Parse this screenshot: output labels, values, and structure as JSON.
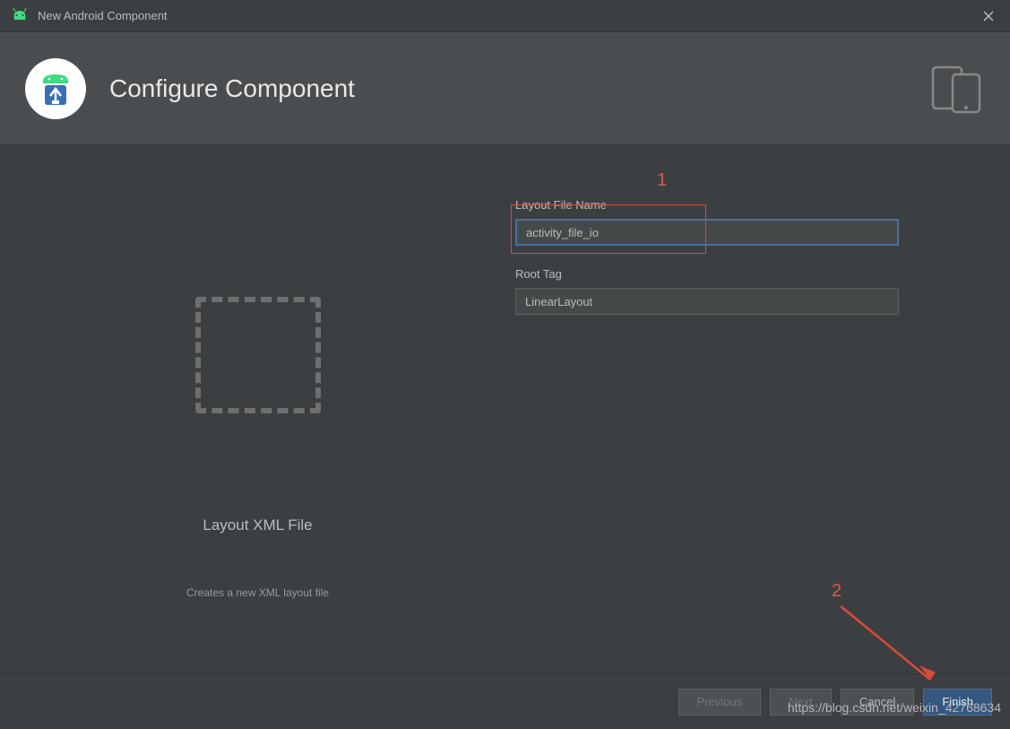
{
  "titlebar": {
    "title": "New Android Component"
  },
  "header": {
    "title": "Configure Component"
  },
  "form": {
    "layout_file_name": {
      "label": "Layout File Name",
      "value": "activity_file_io"
    },
    "root_tag": {
      "label": "Root Tag",
      "value": "LinearLayout"
    }
  },
  "preview": {
    "title": "Layout XML File",
    "subtitle": "Creates a new XML layout file"
  },
  "footer": {
    "previous": "Previous",
    "next": "Next",
    "cancel": "Cancel",
    "finish": "Finish"
  },
  "annotations": {
    "marker1": "1",
    "marker2": "2"
  },
  "watermark": "https://blog.csdn.net/weixin_42768634"
}
